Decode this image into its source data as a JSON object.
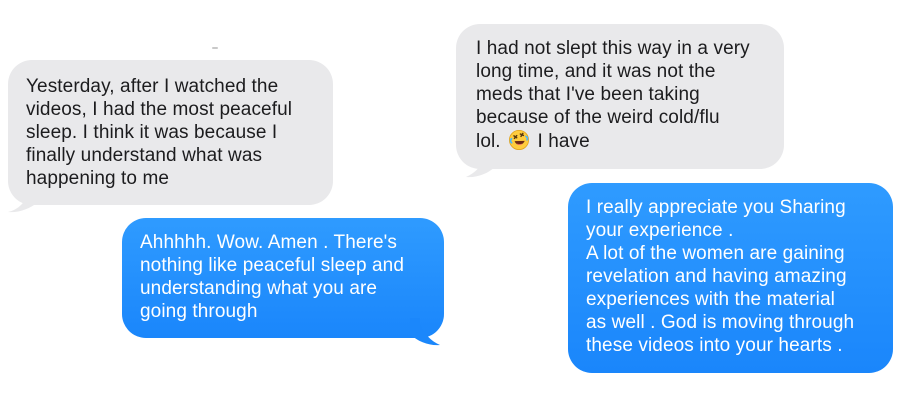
{
  "conversation": {
    "messages": [
      {
        "direction": "received",
        "text": "Yesterday, after I watched the\nvideos, I had the most peaceful\nsleep. I think it was because I\nfinally understand what was\nhappening to me"
      },
      {
        "direction": "received",
        "text_before_emoji": "I had not slept this way in a very\nlong time, and it was not the\nmeds that I've been taking\nbecause of the weird cold/flu\nlol. ",
        "emoji": "rolling-on-floor-laughing-emoji",
        "text_after_emoji": " I have"
      },
      {
        "direction": "sent",
        "text": "Ahhhhh. Wow. Amen . There's\nnothing like peaceful sleep and\nunderstanding what you are\ngoing through"
      },
      {
        "direction": "sent",
        "text": "I really appreciate you Sharing\nyour experience .\nA lot of the women are gaining\nrevelation and having amazing\nexperiences with the material\nas well . God is moving through\nthese videos into your hearts ."
      }
    ]
  },
  "colors": {
    "received_bubble": "#e9e9eb",
    "received_text": "#1c1c1e",
    "sent_bubble": "#1a86fb",
    "sent_text": "#ffffff"
  }
}
